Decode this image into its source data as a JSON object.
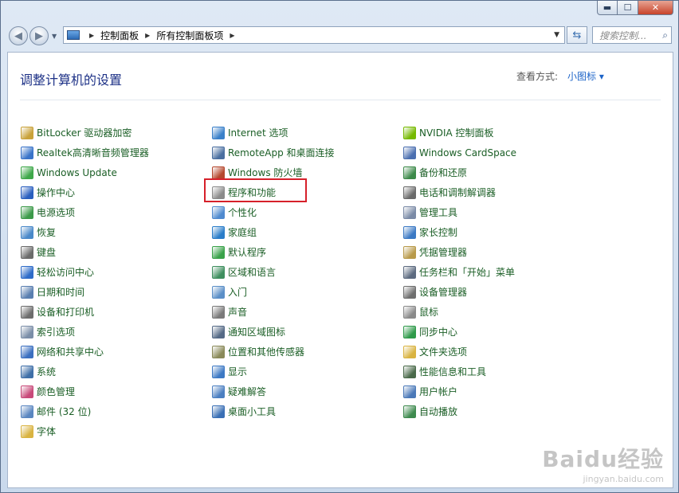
{
  "window": {
    "buttons": {
      "minimize": "▬",
      "maximize": "☐",
      "close": "✕"
    }
  },
  "nav": {
    "back": "◀",
    "forward": "▶",
    "dropdown": "▼",
    "breadcrumb": [
      "控制面板",
      "所有控制面板项"
    ],
    "separator": "▶",
    "refresh": "⇆",
    "search_placeholder": "搜索控制...",
    "search_icon": "⌕"
  },
  "header": {
    "title": "调整计算机的设置",
    "view_by_label": "查看方式:",
    "view_mode": "小图标 ▾"
  },
  "columns": [
    [
      {
        "label": "BitLocker 驱动器加密",
        "icon": "bitlocker-icon",
        "color": "#c9a23a"
      },
      {
        "label": "Realtek高清晰音频管理器",
        "icon": "speaker-icon",
        "color": "#3a74c9"
      },
      {
        "label": "Windows Update",
        "icon": "windows-update-icon",
        "color": "#3ea84a"
      },
      {
        "label": "操作中心",
        "icon": "flag-icon",
        "color": "#2a5fbf"
      },
      {
        "label": "电源选项",
        "icon": "power-icon",
        "color": "#3c9a4a"
      },
      {
        "label": "恢复",
        "icon": "recovery-icon",
        "color": "#4a89c9"
      },
      {
        "label": "键盘",
        "icon": "keyboard-icon",
        "color": "#6b6b6b"
      },
      {
        "label": "轻松访问中心",
        "icon": "accessibility-icon",
        "color": "#2f6cc9"
      },
      {
        "label": "日期和时间",
        "icon": "clock-icon",
        "color": "#5a7fb0"
      },
      {
        "label": "设备和打印机",
        "icon": "printer-icon",
        "color": "#6d6d6d"
      },
      {
        "label": "索引选项",
        "icon": "index-icon",
        "color": "#7b8ea8"
      },
      {
        "label": "网络和共享中心",
        "icon": "network-icon",
        "color": "#3b6fc0"
      },
      {
        "label": "系统",
        "icon": "system-icon",
        "color": "#3f6fa8"
      },
      {
        "label": "颜色管理",
        "icon": "color-icon",
        "color": "#c84a7a"
      },
      {
        "label": "邮件 (32 位)",
        "icon": "mail-icon",
        "color": "#5a86c0"
      },
      {
        "label": "字体",
        "icon": "font-icon",
        "color": "#d9b341"
      }
    ],
    [
      {
        "label": "Internet 选项",
        "icon": "internet-icon",
        "color": "#3a80c9"
      },
      {
        "label": "RemoteApp 和桌面连接",
        "icon": "remoteapp-icon",
        "color": "#4a6fa0"
      },
      {
        "label": "Windows 防火墙",
        "icon": "firewall-icon",
        "color": "#b5482e"
      },
      {
        "label": "程序和功能",
        "icon": "programs-icon",
        "color": "#8b8b8b"
      },
      {
        "label": "个性化",
        "icon": "personalize-icon",
        "color": "#4f8acf"
      },
      {
        "label": "家庭组",
        "icon": "homegroup-icon",
        "color": "#2a7dc9"
      },
      {
        "label": "默认程序",
        "icon": "default-programs-icon",
        "color": "#3aa24a"
      },
      {
        "label": "区域和语言",
        "icon": "globe-icon",
        "color": "#3f8f5f"
      },
      {
        "label": "入门",
        "icon": "getting-started-icon",
        "color": "#5b8fc7"
      },
      {
        "label": "声音",
        "icon": "sound-icon",
        "color": "#7a7a7a"
      },
      {
        "label": "通知区域图标",
        "icon": "notification-icon",
        "color": "#556a86"
      },
      {
        "label": "位置和其他传感器",
        "icon": "sensor-icon",
        "color": "#8a8a5a"
      },
      {
        "label": "显示",
        "icon": "display-icon",
        "color": "#3d79c4"
      },
      {
        "label": "疑难解答",
        "icon": "troubleshoot-icon",
        "color": "#4b7fc1"
      },
      {
        "label": "桌面小工具",
        "icon": "gadgets-icon",
        "color": "#3a6fb5"
      }
    ],
    [
      {
        "label": "NVIDIA 控制面板",
        "icon": "nvidia-icon",
        "color": "#76b900"
      },
      {
        "label": "Windows CardSpace",
        "icon": "cardspace-icon",
        "color": "#4b6fb0"
      },
      {
        "label": "备份和还原",
        "icon": "backup-icon",
        "color": "#3d8a4a"
      },
      {
        "label": "电话和调制解调器",
        "icon": "phone-icon",
        "color": "#6a6a6a"
      },
      {
        "label": "管理工具",
        "icon": "admin-tools-icon",
        "color": "#7a8aa6"
      },
      {
        "label": "家长控制",
        "icon": "parental-icon",
        "color": "#3b79c4"
      },
      {
        "label": "凭据管理器",
        "icon": "credential-icon",
        "color": "#b89a4a"
      },
      {
        "label": "任务栏和「开始」菜单",
        "icon": "taskbar-icon",
        "color": "#5d6b80"
      },
      {
        "label": "设备管理器",
        "icon": "device-manager-icon",
        "color": "#6f6f6f"
      },
      {
        "label": "鼠标",
        "icon": "mouse-icon",
        "color": "#8a8a8a"
      },
      {
        "label": "同步中心",
        "icon": "sync-icon",
        "color": "#2f9a4a"
      },
      {
        "label": "文件夹选项",
        "icon": "folder-icon",
        "color": "#d9b341"
      },
      {
        "label": "性能信息和工具",
        "icon": "performance-icon",
        "color": "#4a6a4a"
      },
      {
        "label": "用户帐户",
        "icon": "users-icon",
        "color": "#4b79b8"
      },
      {
        "label": "自动播放",
        "icon": "autoplay-icon",
        "color": "#3e8a4e"
      }
    ]
  ],
  "watermark": {
    "main": "Baidu经验",
    "sub": "jingyan.baidu.com"
  }
}
